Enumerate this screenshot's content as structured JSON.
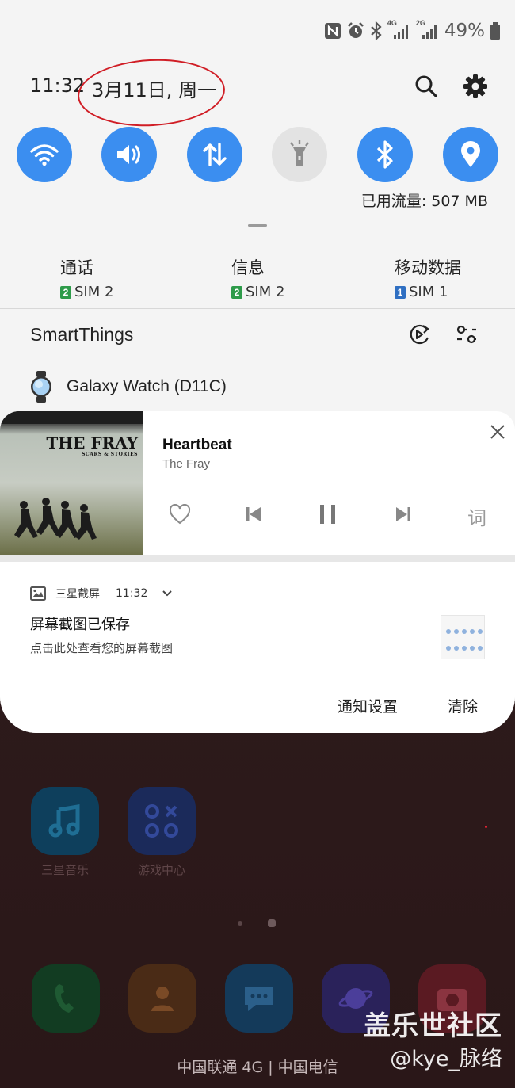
{
  "status_bar": {
    "battery": "49%",
    "icons": [
      "nfc-icon",
      "alarm-icon",
      "bluetooth-icon",
      "4g-signal-icon",
      "2g-signal-icon",
      "battery-icon"
    ],
    "network_labels": {
      "lte": "4G",
      "gsm": "2G"
    }
  },
  "header": {
    "time": "11:32",
    "date": "3月11日, 周一",
    "annotation_color": "#d01d25"
  },
  "quick_settings": {
    "tiles": [
      {
        "name": "wifi",
        "state": "on",
        "icon": "wifi-icon"
      },
      {
        "name": "sound",
        "state": "on",
        "icon": "volume-icon"
      },
      {
        "name": "mobile-data",
        "state": "on",
        "icon": "data-arrows-icon"
      },
      {
        "name": "flashlight",
        "state": "off",
        "icon": "flashlight-icon"
      },
      {
        "name": "bluetooth",
        "state": "on",
        "icon": "bluetooth-icon"
      },
      {
        "name": "location",
        "state": "on",
        "icon": "location-pin-icon"
      }
    ],
    "data_usage": "已用流量: 507 MB",
    "accent": "#3b8ef0"
  },
  "sim_settings": [
    {
      "title": "通话",
      "badge": "2",
      "sim": "SIM 2",
      "badge_color": "#2e9b4a"
    },
    {
      "title": "信息",
      "badge": "2",
      "sim": "SIM 2",
      "badge_color": "#2e9b4a"
    },
    {
      "title": "移动数据",
      "badge": "1",
      "sim": "SIM 1",
      "badge_color": "#2f6fc2"
    }
  ],
  "smartthings": {
    "title": "SmartThings",
    "device": "Galaxy Watch (D11C)"
  },
  "media": {
    "album_title": "THE FRAY",
    "album_subtitle": "SCARS & STORIES",
    "song": "Heartbeat",
    "artist": "The Fray",
    "lyrics_label": "词"
  },
  "notification": {
    "app": "三星截屏",
    "time": "11:32",
    "title": "屏幕截图已保存",
    "text": "点击此处查看您的屏幕截图",
    "settings_label": "通知设置",
    "clear_label": "清除"
  },
  "home": {
    "apps": [
      {
        "label": "三星音乐",
        "icon": "music-note-icon"
      },
      {
        "label": "游戏中心",
        "icon": "game-center-icon"
      }
    ],
    "dock": [
      "phone-icon",
      "contacts-icon",
      "messages-icon",
      "internet-icon",
      "camera-icon"
    ],
    "carrier": "中国联通 4G | 中国电信",
    "watermark_title": "盖乐世社区",
    "watermark_user": "@kye_脉络"
  }
}
